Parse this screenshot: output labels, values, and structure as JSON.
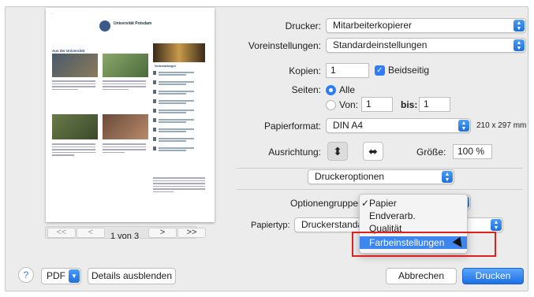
{
  "colors": {
    "accent": "#2f7cf6",
    "highlight_box": "#e0201e",
    "menu_highlight": "#3d85ef"
  },
  "printer": {
    "label": "Drucker:",
    "value": "Mitarbeiterkopierer"
  },
  "presets": {
    "label": "Voreinstellungen:",
    "value": "Standardeinstellungen"
  },
  "copies": {
    "label": "Kopien:",
    "value": "1",
    "duplex_label": "Beidseitig",
    "duplex_checked": true
  },
  "pages": {
    "label": "Seiten:",
    "all_label": "Alle",
    "from_label": "Von:",
    "from_value": "1",
    "to_label": "bis:",
    "to_value": "1"
  },
  "paper_format": {
    "label": "Papierformat:",
    "value": "DIN A4",
    "dimensions": "210 x 297 mm"
  },
  "orientation": {
    "label": "Ausrichtung:",
    "portrait_icon": "portrait-icon",
    "landscape_icon": "landscape-icon"
  },
  "scale": {
    "label": "Größe:",
    "value": "100 %"
  },
  "printer_options": {
    "value": "Druckeroptionen"
  },
  "option_groups": {
    "label": "Optionengruppen",
    "menu_items": [
      "Papier",
      "Endverarb.",
      "Qualität",
      "Farbeinstellungen"
    ],
    "selected": "Papier",
    "highlighted": "Farbeinstellungen"
  },
  "paper_type": {
    "label": "Papiertyp:",
    "value": "Druckerstanda"
  },
  "preview": {
    "page_indicator": "1 von 3",
    "nav": {
      "first": "<<",
      "prev": "<",
      "next": ">",
      "last": ">>"
    },
    "logo_text": "Universität Potsdam",
    "heading": "Aus der Universität",
    "sidebar_heading": "Veranstaltungen"
  },
  "footer": {
    "help": "?",
    "pdf_label": "PDF",
    "details_label": "Details ausblenden",
    "cancel_label": "Abbrechen",
    "print_label": "Drucken"
  }
}
